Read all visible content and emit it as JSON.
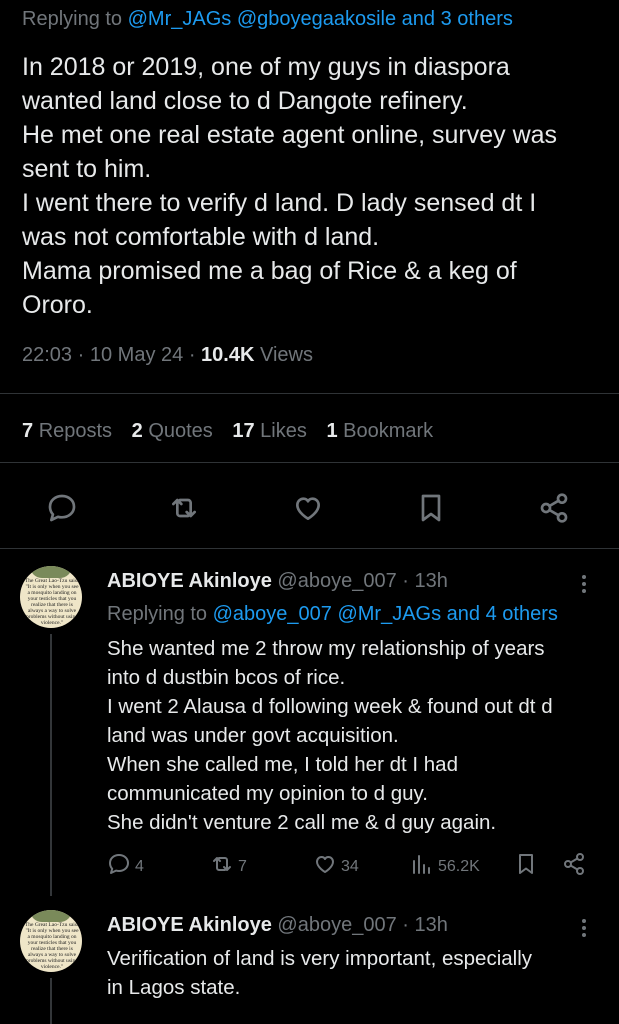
{
  "main_tweet": {
    "replying_prefix": "Replying to",
    "replying_to": "@Mr_JAGs @gboyegaakosile and 3 others",
    "lines": [
      "In 2018 or 2019, one of my guys in diaspora",
      "wanted land close to d Dangote refinery.",
      "He met one real estate agent online, survey was",
      "sent to him.",
      "I went there to verify d land. D lady sensed dt I",
      "was not comfortable with d land.",
      "Mama promised me a bag of Rice & a keg of",
      "Ororo."
    ],
    "time": "22:03",
    "date": "10 May 24",
    "views_count": "10.4K",
    "views_label": "Views",
    "stats": {
      "reposts_count": "7",
      "reposts_label": "Reposts",
      "quotes_count": "2",
      "quotes_label": "Quotes",
      "likes_count": "17",
      "likes_label": "Likes",
      "bookmarks_count": "1",
      "bookmarks_label": "Bookmark"
    },
    "actions": [
      "reply-icon",
      "repost-icon",
      "like-icon",
      "bookmark-icon",
      "share-icon"
    ]
  },
  "replies": [
    {
      "name": "ABIOYE Akinloye",
      "handle": "@aboye_007",
      "age": "13h",
      "replying_prefix": "Replying to",
      "replying_to": "@aboye_007 @Mr_JAGs and 4 others",
      "avatar_text": "The Great Lao-Tzu said: 'It is only when you see a mosquito landing on your testicles that you realize that there is always a way to solve problems without using violence.'",
      "lines": [
        "She wanted me 2 throw my relationship of years",
        "into d dustbin bcos of rice.",
        "I went 2 Alausa d following week & found out dt d",
        "land was under govt acquisition.",
        "When she called me, I told her dt I had",
        "communicated my opinion to d guy.",
        "She didn't venture 2 call me & d guy again."
      ],
      "replies_count": "4",
      "reposts_count": "7",
      "likes_count": "34",
      "views_count": "56.2K"
    },
    {
      "name": "ABIOYE Akinloye",
      "handle": "@aboye_007",
      "age": "13h",
      "avatar_text": "The Great Lao-Tzu said: 'It is only when you see a mosquito landing on your testicles that you realize that there is always a way to solve problems without using violence.'",
      "lines": [
        "Verification of land is very important, especially",
        "in Lagos state."
      ]
    }
  ],
  "colors": {
    "background": "#000000",
    "text": "#e7e9ea",
    "muted": "#71767b",
    "link": "#1d9bf0",
    "divider": "#2f3336"
  }
}
